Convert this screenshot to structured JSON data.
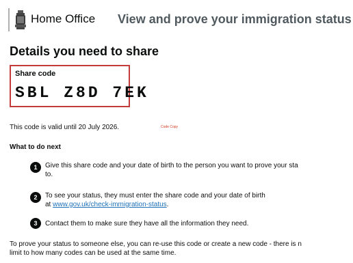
{
  "header": {
    "brand": "Home Office",
    "service": "View and prove your immigration status",
    "crest_icon": "royal-crest-icon"
  },
  "main": {
    "title": "Details you need to share",
    "share_code": {
      "label": "Share code",
      "value": "SBL Z8D 7EK"
    },
    "valid_text": "This code is valid until 20 July 2026.",
    "copy_label": "Code Copy",
    "next_heading": "What to do next",
    "steps": [
      {
        "number": "1",
        "line1": "Give this share code and your date of birth to the person you want to prove your sta",
        "line2": "to."
      },
      {
        "number": "2",
        "line1": "To see your status, they must enter the share code and your date of birth",
        "line2_prefix": "at ",
        "link": "www.gov.uk/check-immigration-status",
        "line2_suffix": "."
      },
      {
        "number": "3",
        "line1": "Contact them to make sure they have all the information they need."
      }
    ],
    "footer_line1": "To prove your status to someone else, you can re-use this code or create a new code - there is n",
    "footer_line2": "limit to how many codes can be used at the same time."
  },
  "colors": {
    "code_border": "#c33b3b",
    "link": "#1d70b8",
    "service_text": "#505a5f"
  }
}
